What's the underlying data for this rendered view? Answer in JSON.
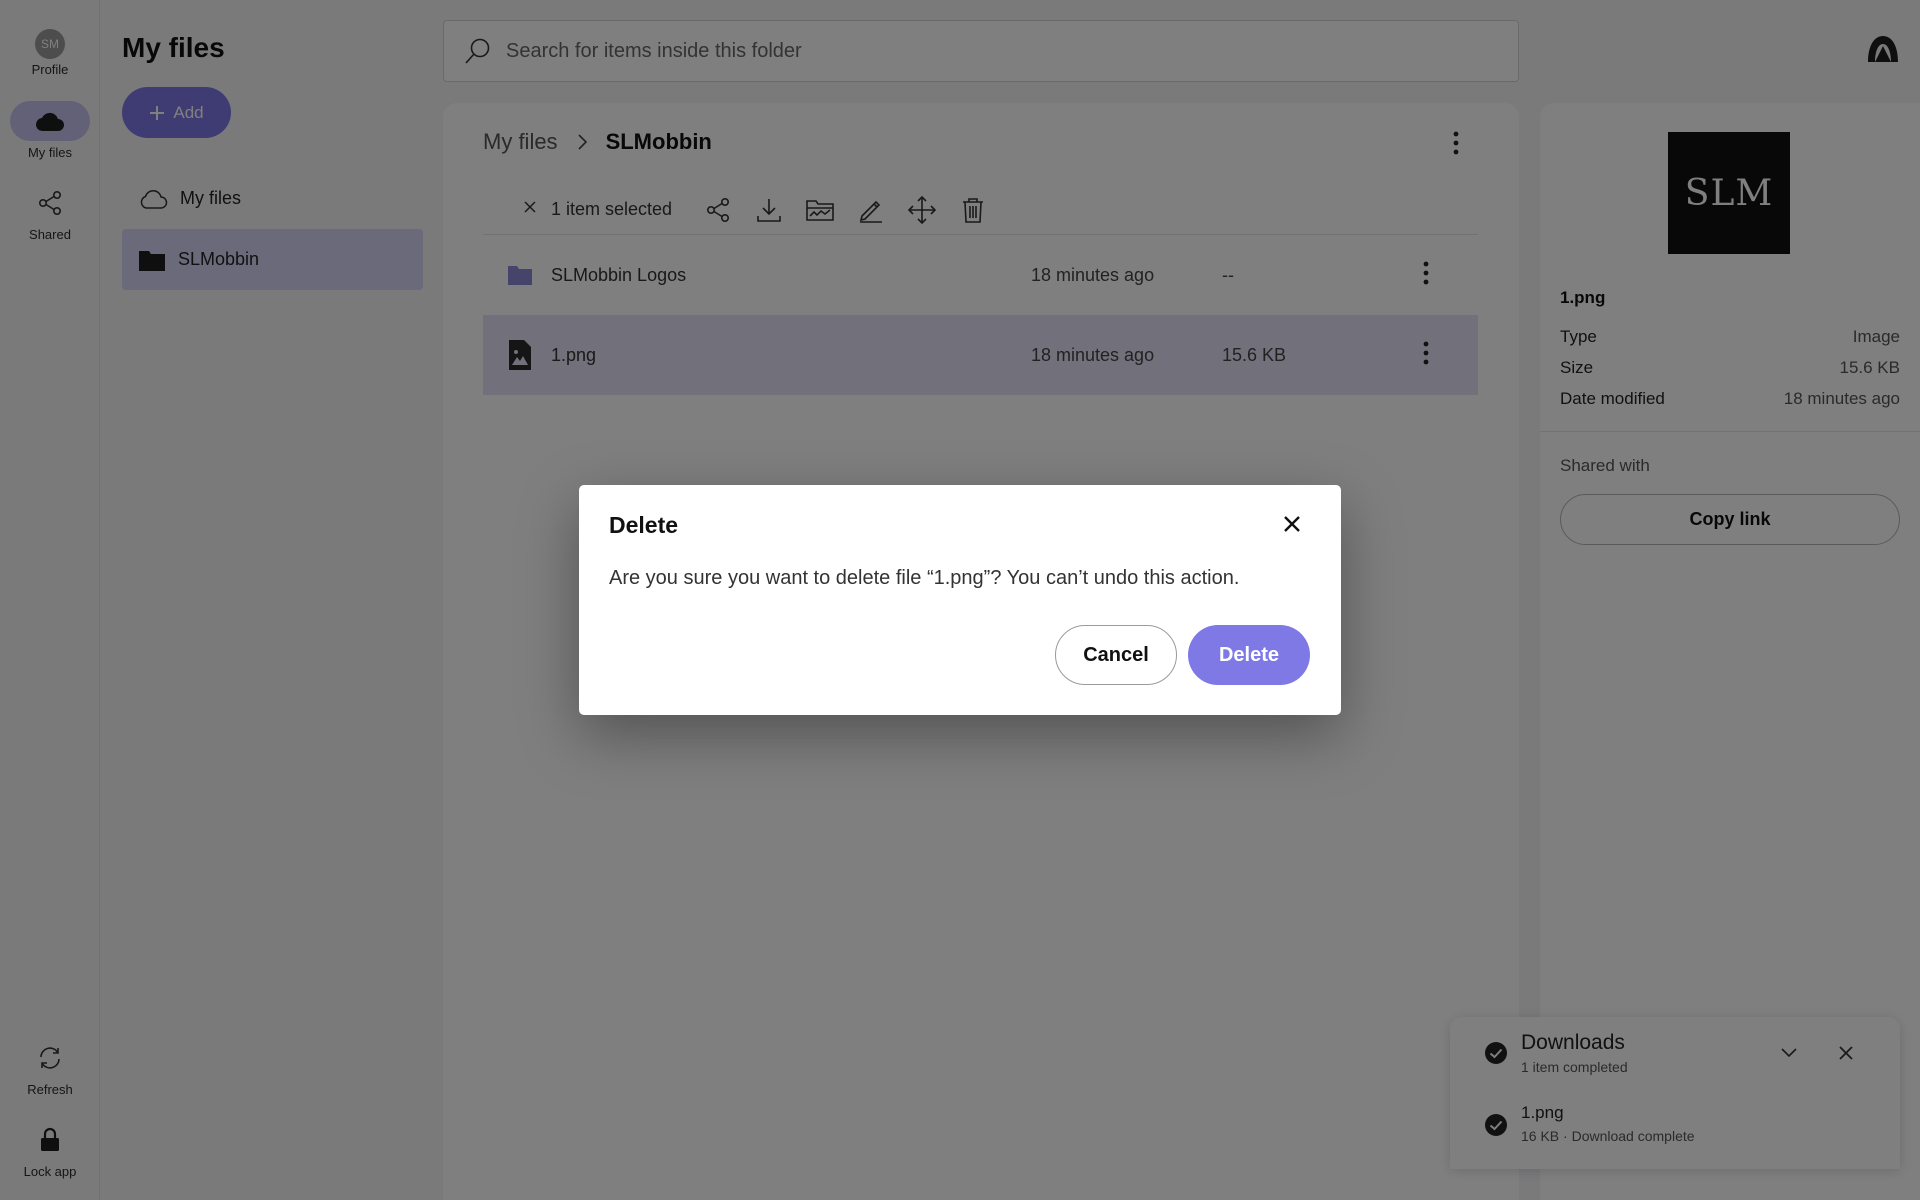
{
  "rail": {
    "profile_initials": "SM",
    "profile_label": "Profile",
    "my_files_label": "My files",
    "shared_label": "Shared",
    "refresh_label": "Refresh",
    "lock_label": "Lock app"
  },
  "folders": {
    "title": "My files",
    "add_label": "Add",
    "items": [
      {
        "label": "My files",
        "icon": "cloud-icon"
      },
      {
        "label": "SLMobbin",
        "icon": "folder-icon",
        "selected": true
      }
    ]
  },
  "search": {
    "placeholder": "Search for items inside this folder"
  },
  "breadcrumb": {
    "root": "My files",
    "current": "SLMobbin"
  },
  "selection": {
    "count_text": "1 item selected"
  },
  "files": {
    "rows": [
      {
        "name": "SLMobbin Logos",
        "modified": "18 minutes ago",
        "size": "--",
        "icon": "folder-icon"
      },
      {
        "name": "1.png",
        "modified": "18 minutes ago",
        "size": "15.6 KB",
        "icon": "image-file-icon",
        "selected": true
      }
    ]
  },
  "details": {
    "thumbnail_text": "SLM",
    "name": "1.png",
    "type_label": "Type",
    "type_value": "Image",
    "size_label": "Size",
    "size_value": "15.6 KB",
    "modified_label": "Date modified",
    "modified_value": "18 minutes ago",
    "shared_with_label": "Shared with",
    "copy_link_label": "Copy link"
  },
  "downloads": {
    "title": "Downloads",
    "subtitle": "1 item completed",
    "file_name": "1.png",
    "file_status": "16 KB · Download complete"
  },
  "dialog": {
    "title": "Delete",
    "message": "Are you sure you want to delete file “1.png”? You can’t undo this action.",
    "cancel_label": "Cancel",
    "delete_label": "Delete"
  },
  "colors": {
    "accent": "#7f79e6",
    "selected_bg": "#d7d4f7",
    "overlay": "rgba(0,0,0,0.5)"
  }
}
